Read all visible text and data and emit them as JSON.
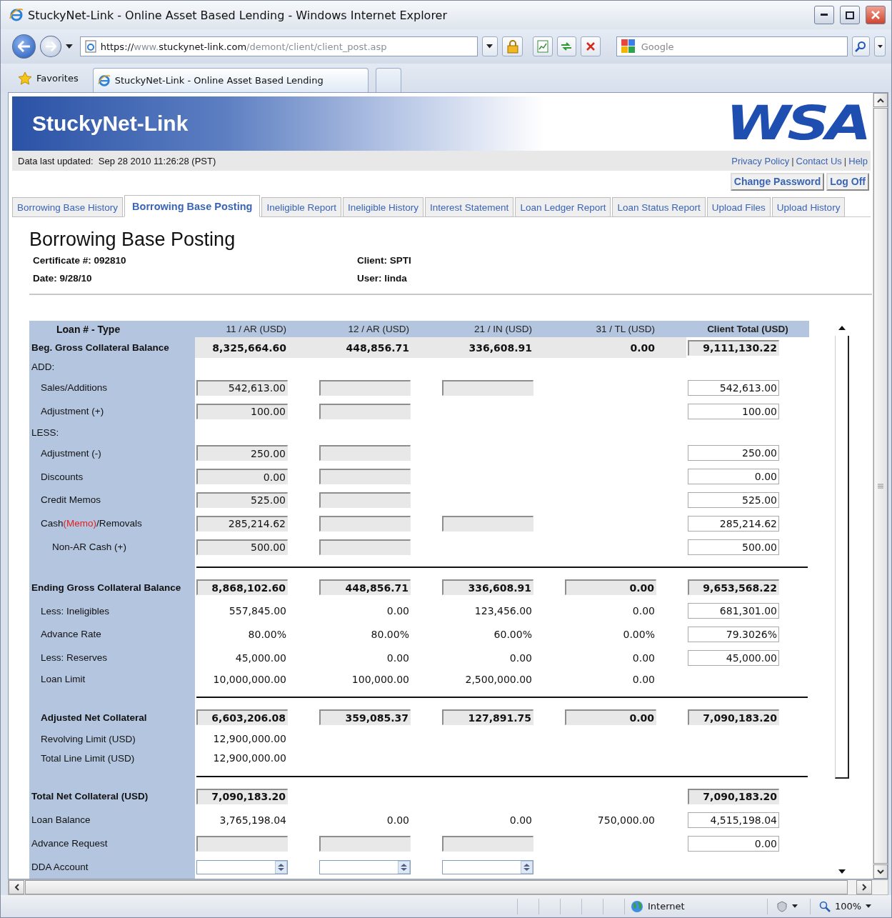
{
  "window": {
    "title": "StuckyNet-Link - Online Asset Based Lending - Windows Internet Explorer"
  },
  "address": {
    "segments": [
      {
        "text": "https://",
        "dim": false
      },
      {
        "text": "www.",
        "dim": true
      },
      {
        "text": "stuckynet-link.com",
        "dim": false
      },
      {
        "text": "/demont/client/client_post.asp",
        "dim": true
      }
    ]
  },
  "search": {
    "placeholder": "Google"
  },
  "favorites": {
    "label": "Favorites"
  },
  "browser_tabs": [
    {
      "label": "StuckyNet-Link - Online Asset Based Lending",
      "selected": true
    }
  ],
  "site": {
    "title": "StuckyNet-Link",
    "logo": "WSA"
  },
  "updated": {
    "text": "Data last updated:  Sep 28 2010 11:26:28 (PST)"
  },
  "links": [
    "Privacy Policy",
    "Contact Us",
    "Help"
  ],
  "link_separator": "|",
  "account_buttons": [
    "Change Password",
    "Log Off"
  ],
  "nav_tabs": [
    {
      "label": "Borrowing Base History",
      "selected": false
    },
    {
      "label": "Borrowing Base Posting",
      "selected": true
    },
    {
      "label": "Ineligible Report",
      "selected": false
    },
    {
      "label": "Ineligible History",
      "selected": false
    },
    {
      "label": "Interest Statement",
      "selected": false
    },
    {
      "label": "Loan Ledger Report",
      "selected": false
    },
    {
      "label": "Loan Status Report",
      "selected": false
    },
    {
      "label": "Upload Files",
      "selected": false
    },
    {
      "label": "Upload History",
      "selected": false
    }
  ],
  "page": {
    "title": "Borrowing Base Posting",
    "info": [
      "Certificate #: 092810",
      "Client: SPTI",
      "Date: 9/28/10",
      "User: linda"
    ]
  },
  "table": {
    "label_header": "Loan # - Type",
    "columns": [
      "11 / AR (USD)",
      "12 / AR (USD)",
      "21 / IN (USD)",
      "31 / TL (USD)",
      "Client Total (USD)"
    ],
    "rows": [
      {
        "kind": "balance",
        "label": "Beg. Gross Collateral Balance",
        "cells": [
          {
            "kind": "bold",
            "value": "8,325,664.60"
          },
          {
            "kind": "bold",
            "value": "448,856.71"
          },
          {
            "kind": "bold",
            "value": "336,608.91"
          },
          {
            "kind": "bold",
            "value": "0.00"
          },
          {
            "kind": "grey-bold",
            "value": "9,111,130.22"
          }
        ]
      },
      {
        "kind": "section",
        "label": "ADD:",
        "cells": []
      },
      {
        "kind": "item",
        "label": "Sales/Additions",
        "cells": [
          {
            "kind": "grey",
            "value": "542,613.00"
          },
          {
            "kind": "blank"
          },
          {
            "kind": "blank"
          },
          {
            "kind": "none"
          },
          {
            "kind": "field",
            "value": "542,613.00"
          }
        ]
      },
      {
        "kind": "item",
        "label": "Adjustment (+)",
        "cells": [
          {
            "kind": "grey",
            "value": "100.00"
          },
          {
            "kind": "blank"
          },
          {
            "kind": "none"
          },
          {
            "kind": "none"
          },
          {
            "kind": "field",
            "value": "100.00"
          }
        ]
      },
      {
        "kind": "section",
        "label": "LESS:",
        "cells": []
      },
      {
        "kind": "item",
        "label": "Adjustment (-)",
        "cells": [
          {
            "kind": "grey",
            "value": "250.00"
          },
          {
            "kind": "blank"
          },
          {
            "kind": "none"
          },
          {
            "kind": "none"
          },
          {
            "kind": "field",
            "value": "250.00"
          }
        ]
      },
      {
        "kind": "item",
        "label": "Discounts",
        "cells": [
          {
            "kind": "grey",
            "value": "0.00"
          },
          {
            "kind": "blank"
          },
          {
            "kind": "none"
          },
          {
            "kind": "none"
          },
          {
            "kind": "field",
            "value": "0.00"
          }
        ]
      },
      {
        "kind": "item",
        "label": "Credit Memos",
        "cells": [
          {
            "kind": "grey",
            "value": "525.00"
          },
          {
            "kind": "blank"
          },
          {
            "kind": "none"
          },
          {
            "kind": "none"
          },
          {
            "kind": "field",
            "value": "525.00"
          }
        ]
      },
      {
        "kind": "item",
        "label": "Cash",
        "note": "(Memo)",
        "label_after": "/Removals",
        "cells": [
          {
            "kind": "grey",
            "value": "285,214.62"
          },
          {
            "kind": "blank"
          },
          {
            "kind": "blank"
          },
          {
            "kind": "none"
          },
          {
            "kind": "field",
            "value": "285,214.62"
          }
        ]
      },
      {
        "kind": "subitem",
        "label": "Non-AR Cash (+)",
        "cells": [
          {
            "kind": "grey",
            "value": "500.00"
          },
          {
            "kind": "blank"
          },
          {
            "kind": "none"
          },
          {
            "kind": "none"
          },
          {
            "kind": "field",
            "value": "500.00"
          }
        ]
      },
      {
        "kind": "rule",
        "cells": []
      },
      {
        "kind": "heading",
        "label": "Ending Gross Collateral Balance",
        "cells": [
          {
            "kind": "grey-bold",
            "value": "8,868,102.60"
          },
          {
            "kind": "grey-bold",
            "value": "448,856.71"
          },
          {
            "kind": "grey-bold",
            "value": "336,608.91"
          },
          {
            "kind": "grey-bold",
            "value": "0.00"
          },
          {
            "kind": "grey-bold",
            "value": "9,653,568.22"
          }
        ]
      },
      {
        "kind": "item",
        "label": "Less: Ineligibles",
        "cells": [
          {
            "kind": "text",
            "value": "557,845.00"
          },
          {
            "kind": "text",
            "value": "0.00"
          },
          {
            "kind": "text",
            "value": "123,456.00"
          },
          {
            "kind": "text",
            "value": "0.00"
          },
          {
            "kind": "field",
            "value": "681,301.00"
          }
        ]
      },
      {
        "kind": "item",
        "label": "Advance Rate",
        "cells": [
          {
            "kind": "text",
            "value": "80.00%"
          },
          {
            "kind": "text",
            "value": "80.00%"
          },
          {
            "kind": "text",
            "value": "60.00%"
          },
          {
            "kind": "text",
            "value": "0.00%"
          },
          {
            "kind": "field",
            "value": "79.3026%"
          }
        ]
      },
      {
        "kind": "item",
        "label": "Less: Reserves",
        "cells": [
          {
            "kind": "text",
            "value": "45,000.00"
          },
          {
            "kind": "text",
            "value": "0.00"
          },
          {
            "kind": "text",
            "value": "0.00"
          },
          {
            "kind": "text",
            "value": "0.00"
          },
          {
            "kind": "field",
            "value": "45,000.00"
          }
        ]
      },
      {
        "kind": "item-small",
        "label": "Loan Limit",
        "cells": [
          {
            "kind": "text",
            "value": "10,000,000.00"
          },
          {
            "kind": "text",
            "value": "100,000.00"
          },
          {
            "kind": "text",
            "value": "2,500,000.00"
          },
          {
            "kind": "text",
            "value": "0.00"
          },
          {
            "kind": "none"
          }
        ]
      },
      {
        "kind": "rule",
        "cells": []
      },
      {
        "kind": "subtotal",
        "label": "Adjusted Net Collateral",
        "cells": [
          {
            "kind": "grey-bold",
            "value": "6,603,206.08"
          },
          {
            "kind": "grey-bold",
            "value": "359,085.37"
          },
          {
            "kind": "grey-bold",
            "value": "127,891.75"
          },
          {
            "kind": "grey-bold",
            "value": "0.00"
          },
          {
            "kind": "grey-bold",
            "value": "7,090,183.20"
          }
        ]
      },
      {
        "kind": "item-small",
        "label": "Revolving Limit (USD)",
        "cells": [
          {
            "kind": "text",
            "value": "12,900,000.00"
          },
          {
            "kind": "none"
          },
          {
            "kind": "none"
          },
          {
            "kind": "none"
          },
          {
            "kind": "none"
          }
        ]
      },
      {
        "kind": "item-small",
        "label": "Total Line Limit (USD)",
        "cells": [
          {
            "kind": "text",
            "value": "12,900,000.00"
          },
          {
            "kind": "none"
          },
          {
            "kind": "none"
          },
          {
            "kind": "none"
          },
          {
            "kind": "none"
          }
        ]
      },
      {
        "kind": "rule",
        "cells": []
      },
      {
        "kind": "heading",
        "label": "Total Net Collateral (USD)",
        "cells": [
          {
            "kind": "grey-bold",
            "value": "7,090,183.20"
          },
          {
            "kind": "none"
          },
          {
            "kind": "none"
          },
          {
            "kind": "none"
          },
          {
            "kind": "grey-bold",
            "value": "7,090,183.20"
          }
        ]
      },
      {
        "kind": "plain",
        "label": "Loan Balance",
        "cells": [
          {
            "kind": "text",
            "value": "3,765,198.04"
          },
          {
            "kind": "text",
            "value": "0.00"
          },
          {
            "kind": "text",
            "value": "0.00"
          },
          {
            "kind": "text",
            "value": "750,000.00"
          },
          {
            "kind": "field",
            "value": "4,515,198.04"
          }
        ]
      },
      {
        "kind": "plain",
        "label": "Advance Request",
        "cells": [
          {
            "kind": "blank"
          },
          {
            "kind": "blank"
          },
          {
            "kind": "blank"
          },
          {
            "kind": "none"
          },
          {
            "kind": "field",
            "value": "0.00"
          }
        ]
      },
      {
        "kind": "plain",
        "label": "DDA Account",
        "cells": [
          {
            "kind": "select"
          },
          {
            "kind": "select"
          },
          {
            "kind": "select"
          },
          {
            "kind": "none"
          },
          {
            "kind": "none"
          }
        ]
      }
    ]
  },
  "status_bar": {
    "zone": "Internet",
    "zoom": "100%"
  }
}
